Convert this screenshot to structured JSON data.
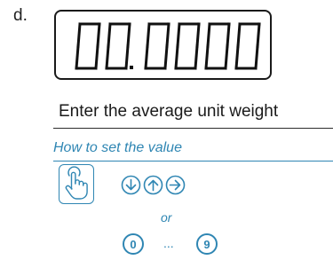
{
  "step": {
    "letter": "d."
  },
  "display": {
    "digits": [
      "0",
      "0",
      "0",
      "0",
      "0",
      "0"
    ],
    "decimal_after_index": 1
  },
  "instruction": {
    "text": "Enter the average unit weight"
  },
  "howto": {
    "title": "How to set the value",
    "or_text": "or",
    "key_first": "0",
    "ellipsis": "...",
    "key_last": "9"
  },
  "colors": {
    "accent": "#2f86b3",
    "text": "#1a1a1a"
  },
  "icons": [
    "press-hand-icon",
    "arrow-down-icon",
    "arrow-up-icon",
    "arrow-right-icon"
  ]
}
